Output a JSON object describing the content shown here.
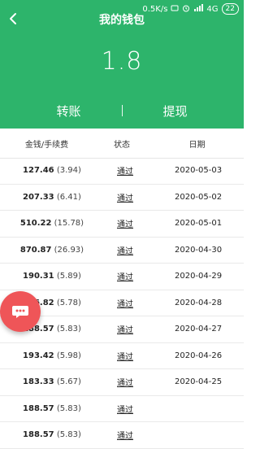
{
  "status_bar": {
    "speed": "0.5K/s",
    "network": "4G",
    "battery": "22"
  },
  "header": {
    "title": "我的钱包",
    "balance": "1.8",
    "actions": {
      "transfer": "转账",
      "separator": "|",
      "withdraw": "提现"
    },
    "colors": {
      "primary": "#2db46b",
      "fab": "#ef5558"
    }
  },
  "table": {
    "headers": {
      "amount": "金钱/手续费",
      "status": "状态",
      "date": "日期"
    },
    "rows": [
      {
        "amount": "127.46",
        "fee": "(3.94)",
        "status": "通过",
        "date": "2020-05-03"
      },
      {
        "amount": "207.33",
        "fee": "(6.41)",
        "status": "通过",
        "date": "2020-05-02"
      },
      {
        "amount": "510.22",
        "fee": "(15.78)",
        "status": "通过",
        "date": "2020-05-01"
      },
      {
        "amount": "870.87",
        "fee": "(26.93)",
        "status": "通过",
        "date": "2020-04-30"
      },
      {
        "amount": "190.31",
        "fee": "(5.89)",
        "status": "通过",
        "date": "2020-04-29"
      },
      {
        "amount": "186.82",
        "fee": "(5.78)",
        "status": "通过",
        "date": "2020-04-28"
      },
      {
        "amount": "188.57",
        "fee": "(5.83)",
        "status": "通过",
        "date": "2020-04-27"
      },
      {
        "amount": "193.42",
        "fee": "(5.98)",
        "status": "通过",
        "date": "2020-04-26"
      },
      {
        "amount": "183.33",
        "fee": "(5.67)",
        "status": "通过",
        "date": "2020-04-25"
      },
      {
        "amount": "188.57",
        "fee": "(5.83)",
        "status": "通过",
        "date": ""
      },
      {
        "amount": "188.57",
        "fee": "(5.83)",
        "status": "通过",
        "date": ""
      }
    ]
  },
  "icons": {
    "back": "chevron-left-icon",
    "fab": "chat-bubble-icon",
    "status_alarm": "alarm-icon",
    "status_message": "message-icon",
    "status_signal": "signal-icon"
  }
}
